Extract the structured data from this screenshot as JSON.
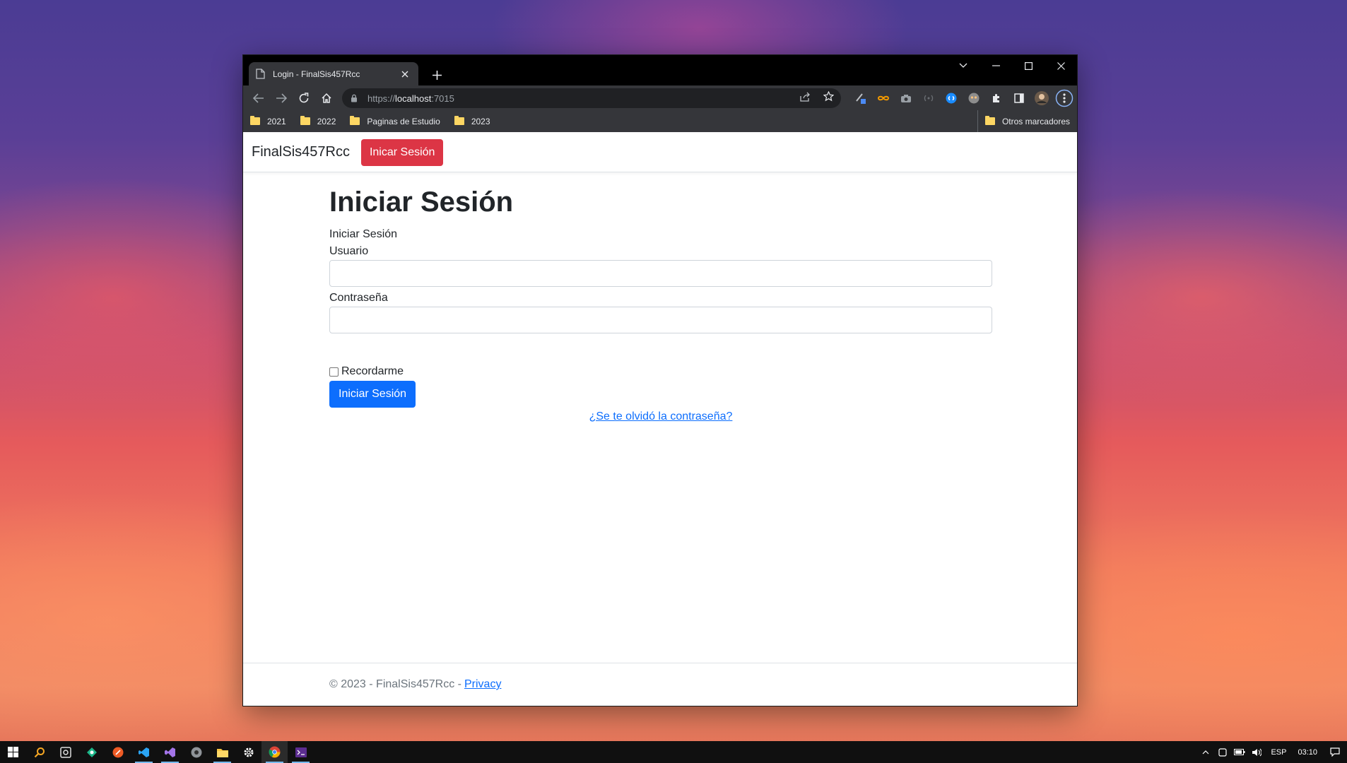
{
  "browser": {
    "tab_title": "Login - FinalSis457Rcc",
    "url_scheme": "https://",
    "url_host": "localhost",
    "url_port": ":7015",
    "bookmarks": [
      "2021",
      "2022",
      "Paginas de Estudio",
      "2023"
    ],
    "other_bookmarks": "Otros marcadores"
  },
  "page": {
    "brand": "FinalSis457Rcc",
    "nav_button": "Inicar Sesión",
    "title": "Iniciar Sesión",
    "subtitle": "Iniciar Sesión",
    "username_label": "Usuario",
    "username_value": "",
    "password_label": "Contraseña",
    "password_value": "",
    "remember_label": "Recordarme",
    "remember_checked": false,
    "submit_label": "Iniciar Sesión",
    "forgot_link": "¿Se te olvidó la contraseña?",
    "footer_text": "© 2023 - FinalSis457Rcc -",
    "footer_link": "Privacy"
  },
  "taskbar": {
    "language": "ESP",
    "time": "03:10"
  },
  "colors": {
    "danger": "#dc3545",
    "primary": "#0d6efd",
    "chrome_dark": "#35363a"
  }
}
